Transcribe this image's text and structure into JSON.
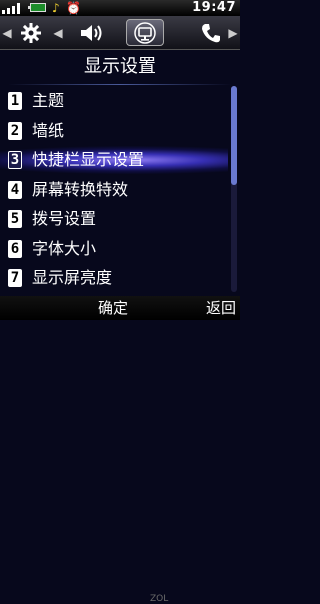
{
  "status_bar": {
    "time": "19:47",
    "icons": [
      "signal-icon",
      "battery-icon",
      "music-icon",
      "alarm-icon"
    ]
  },
  "tab_bar": {
    "tabs": [
      {
        "icon": "gear-icon"
      },
      {
        "icon": "speaker-icon"
      },
      {
        "icon": "display-icon",
        "active": true
      },
      {
        "icon": "phone-icon"
      }
    ]
  },
  "page": {
    "title": "显示设置"
  },
  "menu": {
    "items": [
      {
        "number": "1",
        "label": "主题"
      },
      {
        "number": "2",
        "label": "墙纸"
      },
      {
        "number": "3",
        "label": "快捷栏显示设置",
        "selected": true
      },
      {
        "number": "4",
        "label": "屏幕转换特效"
      },
      {
        "number": "5",
        "label": "拨号设置"
      },
      {
        "number": "6",
        "label": "字体大小"
      },
      {
        "number": "7",
        "label": "显示屏亮度"
      }
    ]
  },
  "scroll": {
    "visible_fraction": 0.48
  },
  "softkeys": {
    "left": "确定",
    "right": "返回"
  },
  "watermark": "ZOL",
  "colors": {
    "background": "#07081c",
    "highlight": "#4a3cf0",
    "clock": "#ffffff"
  }
}
